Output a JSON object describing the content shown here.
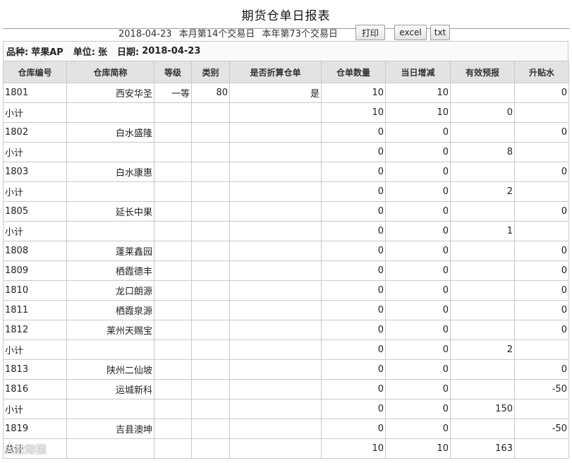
{
  "page_title": "期货仓单日报表",
  "header": {
    "date": "2018-04-23",
    "month_day": "本月第14个交易日",
    "year_day": "本年第73个交易日"
  },
  "buttons": {
    "print": "打印",
    "excel": "excel",
    "txt": "txt"
  },
  "info": {
    "variety_label": "品种:",
    "variety": "苹果AP",
    "unit_label": "单位:",
    "unit": "张",
    "date_label": "日期:",
    "date": "2018-04-23"
  },
  "columns": [
    "仓库编号",
    "仓库简称",
    "等级",
    "类别",
    "是否折算仓单",
    "仓单数量",
    "当日增减",
    "有效预报",
    "升贴水"
  ],
  "rows": [
    [
      "1801",
      "西安华圣",
      "一等",
      "80",
      "是",
      "10",
      "10",
      "",
      "0"
    ],
    [
      "小计",
      "",
      "",
      "",
      "",
      "10",
      "10",
      "0",
      ""
    ],
    [
      "1802",
      "白水盛隆",
      "",
      "",
      "",
      "0",
      "0",
      "",
      "0"
    ],
    [
      "小计",
      "",
      "",
      "",
      "",
      "0",
      "0",
      "8",
      ""
    ],
    [
      "1803",
      "白水康惠",
      "",
      "",
      "",
      "0",
      "0",
      "",
      "0"
    ],
    [
      "小计",
      "",
      "",
      "",
      "",
      "0",
      "0",
      "2",
      ""
    ],
    [
      "1805",
      "延长中果",
      "",
      "",
      "",
      "0",
      "0",
      "",
      "0"
    ],
    [
      "小计",
      "",
      "",
      "",
      "",
      "0",
      "0",
      "1",
      ""
    ],
    [
      "1808",
      "蓬莱鑫园",
      "",
      "",
      "",
      "0",
      "0",
      "",
      "0"
    ],
    [
      "1809",
      "栖霞德丰",
      "",
      "",
      "",
      "0",
      "0",
      "",
      "0"
    ],
    [
      "1810",
      "龙口朗源",
      "",
      "",
      "",
      "0",
      "0",
      "",
      "0"
    ],
    [
      "1811",
      "栖霞泉源",
      "",
      "",
      "",
      "0",
      "0",
      "",
      "0"
    ],
    [
      "1812",
      "莱州天赐宝",
      "",
      "",
      "",
      "0",
      "0",
      "",
      "0"
    ],
    [
      "小计",
      "",
      "",
      "",
      "",
      "0",
      "0",
      "2",
      ""
    ],
    [
      "1813",
      "陕州二仙坡",
      "",
      "",
      "",
      "0",
      "0",
      "",
      "0"
    ],
    [
      "1816",
      "运城新科",
      "",
      "",
      "",
      "0",
      "0",
      "",
      "-50"
    ],
    [
      "小计",
      "",
      "",
      "",
      "",
      "0",
      "0",
      "150",
      ""
    ],
    [
      "1819",
      "吉县澳坤",
      "",
      "",
      "",
      "0",
      "0",
      "",
      "-50"
    ],
    [
      "总计",
      "",
      "",
      "",
      "",
      "10",
      "10",
      "163",
      ""
    ]
  ],
  "watermark": "大数踪猿"
}
